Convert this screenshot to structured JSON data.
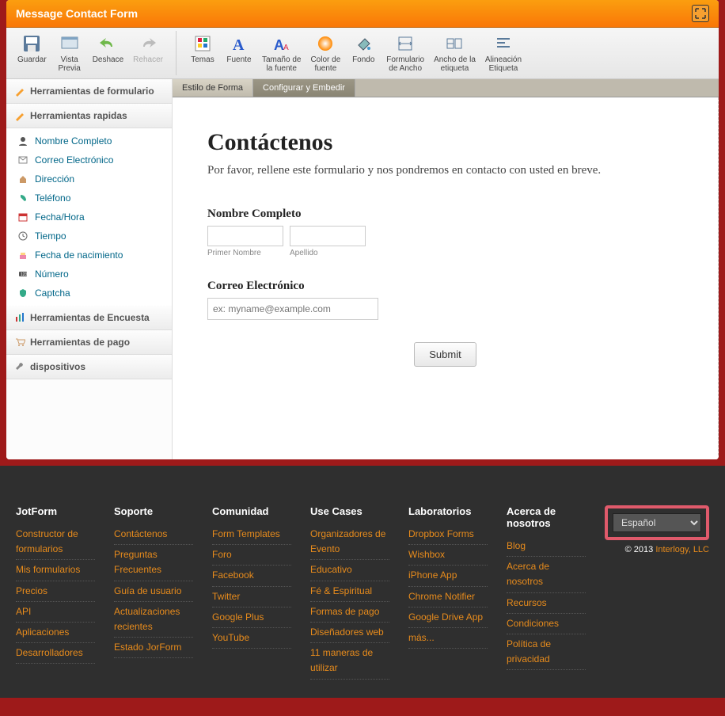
{
  "window_title": "Message Contact Form",
  "toolbar": {
    "buttons": [
      {
        "label": "Guardar"
      },
      {
        "label": "Vista\nPrevia"
      },
      {
        "label": "Deshace"
      },
      {
        "label": "Rehacer"
      }
    ],
    "buttons2": [
      {
        "label": "Temas"
      },
      {
        "label": "Fuente"
      },
      {
        "label": "Tamaño de\nla fuente"
      },
      {
        "label": "Color de\nfuente"
      },
      {
        "label": "Fondo"
      },
      {
        "label": "Formulario\nde Ancho"
      },
      {
        "label": "Ancho de la\netiqueta"
      },
      {
        "label": "Alineación\nEtiqueta"
      }
    ]
  },
  "sidebar": {
    "heads": [
      "Herramientas de formulario",
      "Herramientas rapidas",
      "Herramientas de Encuesta",
      "Herramientas de pago",
      "dispositivos"
    ],
    "items": [
      "Nombre Completo",
      "Correo Electrónico",
      "Dirección",
      "Teléfono",
      "Fecha/Hora",
      "Tiempo",
      "Fecha de nacimiento",
      "Número",
      "Captcha"
    ]
  },
  "tabs": {
    "left": "Estilo de Forma",
    "right": "Configurar y Embedir"
  },
  "form": {
    "title": "Contáctenos",
    "subtitle": "Por favor, rellene este formulario y nos pondremos en contacto con usted en breve.",
    "name_label": "Nombre Completo",
    "first_sub": "Primer Nombre",
    "last_sub": "Apellido",
    "email_label": "Correo Electrónico",
    "email_placeholder": "ex: myname@example.com",
    "submit": "Submit"
  },
  "footer": {
    "cols": [
      {
        "title": "JotForm",
        "links": [
          "Constructor de formularios",
          "Mis formularios",
          "Precios",
          "API",
          "Aplicaciones",
          "Desarrolladores"
        ]
      },
      {
        "title": "Soporte",
        "links": [
          "Contáctenos",
          "Preguntas Frecuentes",
          "Guía de usuario",
          "Actualizaciones recientes",
          "Estado JorForm"
        ]
      },
      {
        "title": "Comunidad",
        "links": [
          "Form Templates",
          "Foro",
          "Facebook",
          "Twitter",
          "Google Plus",
          "YouTube"
        ]
      },
      {
        "title": "Use Cases",
        "links": [
          "Organizadores de Evento",
          "Educativo",
          "Fé & Espiritual",
          "Formas de pago",
          "Diseñadores web",
          "11 maneras de utilizar"
        ]
      },
      {
        "title": "Laboratorios",
        "links": [
          "Dropbox Forms",
          "Wishbox",
          "iPhone App",
          "Chrome Notifier",
          "Google Drive App",
          "más..."
        ]
      },
      {
        "title": "Acerca de nosotros",
        "links": [
          "Blog",
          "Acerca de nosotros",
          "Recursos",
          "Condiciones",
          "Política de privacidad"
        ]
      }
    ],
    "lang": "Español",
    "copyright": "© 2013 ",
    "copyright_link": "Interlogy, LLC"
  }
}
